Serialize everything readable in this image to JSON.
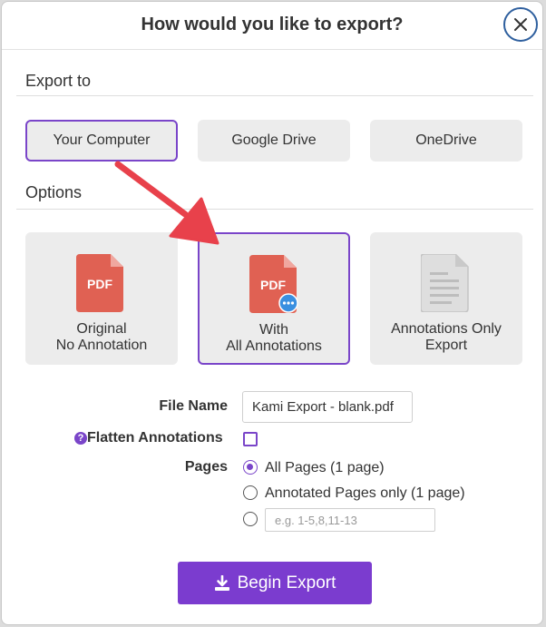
{
  "dialog": {
    "title": "How would you like to export?"
  },
  "export_to": {
    "label": "Export to",
    "options": [
      {
        "label": "Your Computer",
        "selected": true
      },
      {
        "label": "Google Drive",
        "selected": false
      },
      {
        "label": "OneDrive",
        "selected": false
      }
    ]
  },
  "options": {
    "label": "Options",
    "cards": [
      {
        "line1": "Original",
        "line2": "No Annotation",
        "icon": "pdf-icon",
        "selected": false
      },
      {
        "line1": "With",
        "line2": "All Annotations",
        "icon": "pdf-annotated-icon",
        "selected": true
      },
      {
        "line1": "Annotations Only",
        "line2": "Export",
        "icon": "document-icon",
        "selected": false
      }
    ]
  },
  "form": {
    "file_name_label": "File Name",
    "file_name_value": "Kami Export - blank.pdf",
    "flatten_label": "Flatten Annotations",
    "flatten_checked": false,
    "pages_label": "Pages",
    "pages_options": [
      {
        "label": "All Pages (1 page)",
        "checked": true
      },
      {
        "label": "Annotated Pages only (1 page)",
        "checked": false
      }
    ],
    "range_placeholder": "e.g. 1-5,8,11-13"
  },
  "actions": {
    "begin_export_label": "Begin Export"
  },
  "icons": {
    "pdf_text": "PDF",
    "help_text": "?"
  },
  "colors": {
    "accent": "#7b3ccf",
    "pdf_red": "#e06153",
    "annotation_arrow": "#e8414b",
    "close_border": "#2e5f9e"
  }
}
